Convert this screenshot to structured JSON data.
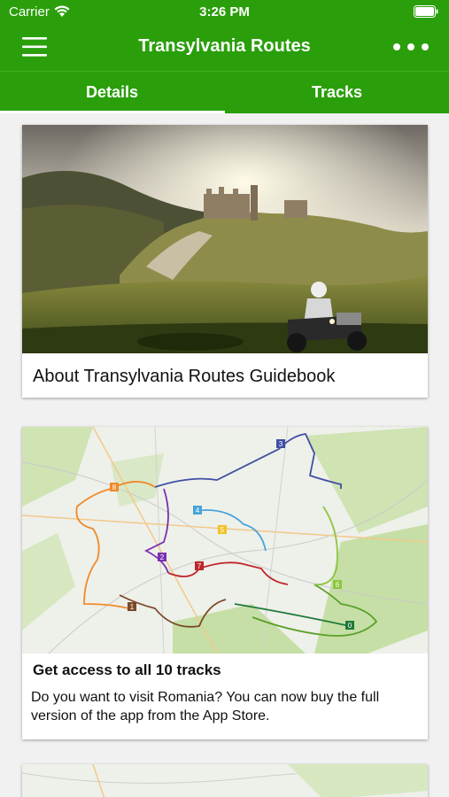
{
  "status_bar": {
    "carrier": "Carrier",
    "time": "3:26 PM"
  },
  "navbar": {
    "title": "Transylvania Routes",
    "menu_icon": "hamburger-menu-icon",
    "more_icon": "more-dots-icon"
  },
  "tabs": [
    {
      "label": "Details",
      "selected": true
    },
    {
      "label": "Tracks",
      "selected": false
    }
  ],
  "cards": [
    {
      "title": "About Transylvania Routes Guidebook",
      "image": "castle-ruins-motorcycle-photo"
    },
    {
      "title": "Get access to all 10 tracks",
      "text": "Do you want to visit Romania? You can now buy the full version of the app from the App Store.",
      "image": "route-map-image"
    },
    {
      "title": "",
      "image": "map-image"
    }
  ],
  "map": {
    "track_markers": [
      "3",
      "8",
      "4",
      "5",
      "2",
      "7",
      "1",
      "6",
      "0"
    ]
  },
  "colors": {
    "brand_green": "#2a9f0b",
    "tab_indicator": "#ffffff"
  }
}
